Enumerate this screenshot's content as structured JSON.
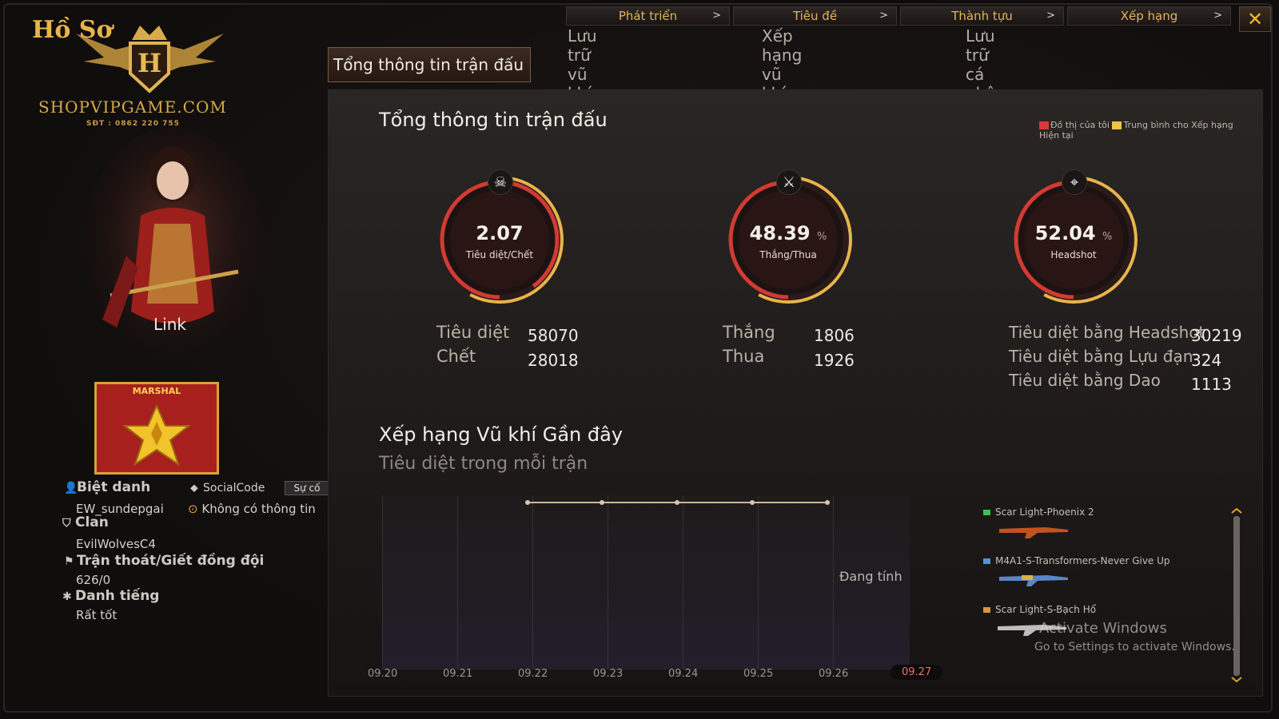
{
  "window": {
    "close_glyph": "✕"
  },
  "topnav": [
    {
      "label": "Phát triển",
      "chev": ">"
    },
    {
      "label": "Tiêu đề",
      "chev": ">"
    },
    {
      "label": "Thành tựu",
      "chev": ">"
    },
    {
      "label": "Xếp hạng",
      "chev": ">"
    }
  ],
  "left": {
    "ho_so": "Hồ Sơ",
    "watermark": {
      "shop": "SHOPVIPGAME.COM",
      "sdt": "SĐT : 0862 220 755"
    },
    "character_name": "Link",
    "rank_badge": "MARSHAL",
    "nickname_label": "Biệt danh",
    "nickname": "EW_sundepgai",
    "socialcode_label": "SocialCode",
    "incident_button": "Sự cố",
    "socialcode_value": "Không có thông tin",
    "clan_label": "Clan",
    "clan": "EvilWolvesC4",
    "escape_label": "Trận thoát/Giết đồng đội",
    "escape": "626/0",
    "reputation_label": "Danh tiếng",
    "reputation": "Rất tốt"
  },
  "tabs": [
    "Tổng thông tin trận đấu",
    "Lưu trữ vũ khí",
    "Xếp hạng vũ khí",
    "Lưu trữ cá nhân"
  ],
  "summary": {
    "title": "Tổng thông tin trận đấu",
    "legend": {
      "mine": "Đồ thị của tôi",
      "avg": "Trung bình cho Xếp hạng Hiện tại",
      "mine_color": "#d83a3a",
      "avg_color": "#f0c24a"
    },
    "gauges": [
      {
        "value": "2.07",
        "unit": "",
        "label": "Tiêu diệt/Chết",
        "icon": "skull-icon",
        "glyph": "☠",
        "fill": 0.9
      },
      {
        "value": "48.39",
        "unit": "%",
        "label": "Thắng/Thua",
        "icon": "crossed-swords-icon",
        "glyph": "⚔",
        "fill": 0.4839
      },
      {
        "value": "52.04",
        "unit": "%",
        "label": "Headshot",
        "icon": "headshot-icon",
        "glyph": "⌖",
        "fill": 0.5204
      }
    ],
    "stats_kd": [
      {
        "label": "Tiêu diệt",
        "value": "58070"
      },
      {
        "label": "Chết",
        "value": "28018"
      }
    ],
    "stats_wl": [
      {
        "label": "Thắng",
        "value": "1806"
      },
      {
        "label": "Thua",
        "value": "1926"
      }
    ],
    "stats_kill": [
      {
        "label": "Tiêu diệt bằng Headshot",
        "value": "30219"
      },
      {
        "label": "Tiêu diệt bằng Lựu đạn",
        "value": "324"
      },
      {
        "label": "Tiêu diệt bằng Dao",
        "value": "1113"
      }
    ]
  },
  "recent": {
    "title": "Xếp hạng Vũ khí Gần đây",
    "subtitle": "Tiêu diệt trong mỗi trận",
    "status": "Đang tính",
    "dates": [
      "09.20",
      "09.21",
      "09.22",
      "09.23",
      "09.24",
      "09.25",
      "09.26",
      "09.27"
    ],
    "selected_date": "09.27",
    "weapons": [
      {
        "name": "Scar Light-Phoenix 2",
        "color": "#3fbf4f"
      },
      {
        "name": "M4A1-S-Transformers-Never Give Up",
        "color": "#5a8fd6"
      },
      {
        "name": "Scar Light-S-Bạch Hổ",
        "color": "#d69a3a"
      }
    ]
  },
  "activation": {
    "title": "Activate Windows",
    "sub": "Go to Settings to activate Windows."
  }
}
